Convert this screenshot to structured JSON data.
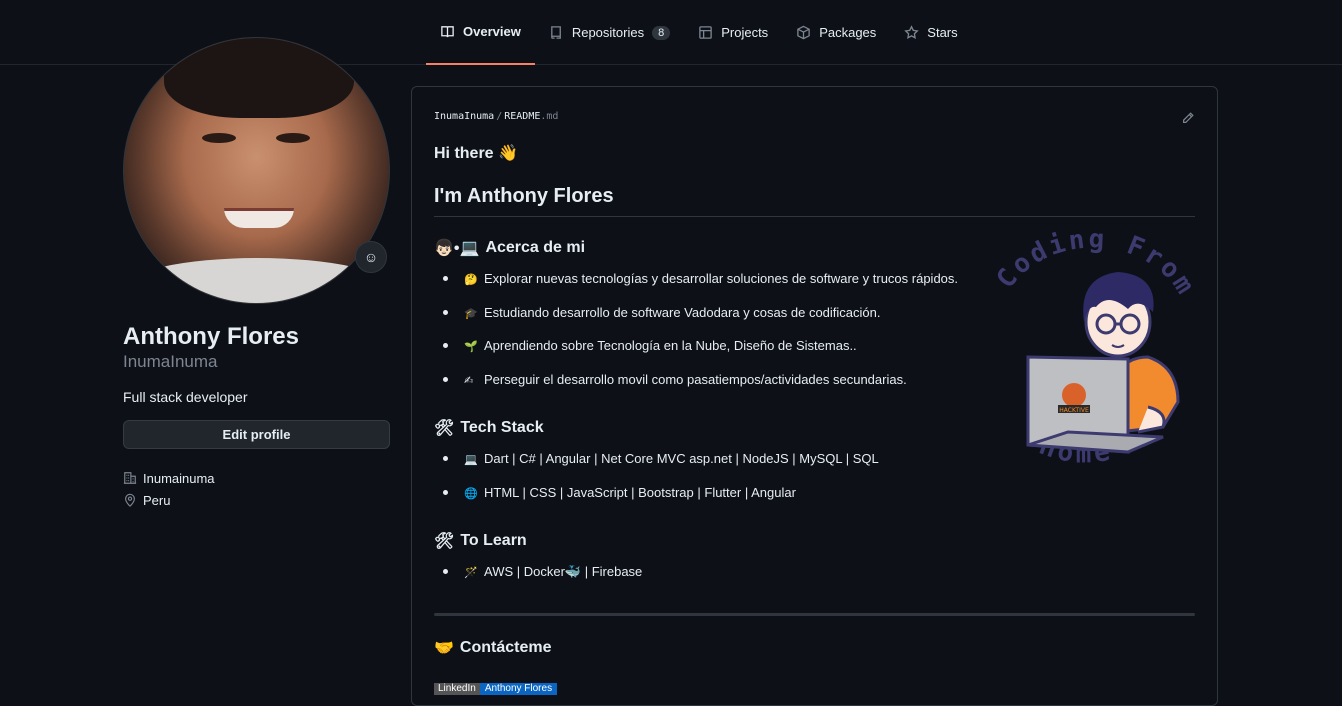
{
  "tabs": [
    {
      "label": "Overview",
      "icon": "book-icon",
      "active": true
    },
    {
      "label": "Repositories",
      "icon": "repo-icon",
      "count": "8"
    },
    {
      "label": "Projects",
      "icon": "table-icon"
    },
    {
      "label": "Packages",
      "icon": "package-icon"
    },
    {
      "label": "Stars",
      "icon": "star-icon"
    }
  ],
  "profile": {
    "name": "Anthony Flores",
    "login": "InumaInuma",
    "bio": "Full stack developer",
    "edit_label": "Edit profile",
    "organization": "Inumainuma",
    "location": "Peru"
  },
  "readme": {
    "owner": "InumaInuma",
    "separator": "/",
    "file": "README",
    "ext": ".md",
    "greeting": "Hi there 👋",
    "heading": "I'm Anthony Flores",
    "about_heading": "Acerca de mi",
    "about_emoji": "👦🏻•💻",
    "about_items": [
      {
        "emoji": "🤔",
        "text": "Explorar nuevas tecnologías y desarrollar soluciones de software y trucos rápidos."
      },
      {
        "emoji": "🎓",
        "text": "Estudiando desarrollo de software Vadodara y cosas de codificación."
      },
      {
        "emoji": "🌱",
        "text": "Aprendiendo sobre Tecnología en la Nube, Diseño de Sistemas.."
      },
      {
        "emoji": "✍",
        "text": "Perseguir el desarrollo movil como pasatiempos/actividades secundarias."
      }
    ],
    "stack_heading": "Tech Stack",
    "stack_emoji": "🛠",
    "stack_items": [
      {
        "emoji": "💻",
        "text": "Dart | C# | Angular | Net Core MVC asp.net | NodeJS | MySQL | SQL"
      },
      {
        "emoji": "🌐",
        "text": "HTML | CSS | JavaScript | Bootstrap | Flutter | Angular"
      }
    ],
    "learn_heading": "To Learn",
    "learn_emoji": "🛠",
    "learn_items": [
      {
        "emoji": "🪄",
        "text": "AWS | Docker🐳 | Firebase"
      }
    ],
    "contact_heading": "Contácteme",
    "contact_emoji": "🤝",
    "badge_left": "LinkedIn",
    "badge_right": "Anthony Flores",
    "art_top_text": "Coding From",
    "art_bottom_text": "Home",
    "art_badge_text": "HACKTIVE"
  },
  "colors": {
    "background": "#0d1117",
    "border": "#30363d",
    "accent_tab": "#f78166",
    "muted": "#7d8590",
    "art_text": "#3d3a70",
    "art_shirt": "#f28a2e"
  }
}
